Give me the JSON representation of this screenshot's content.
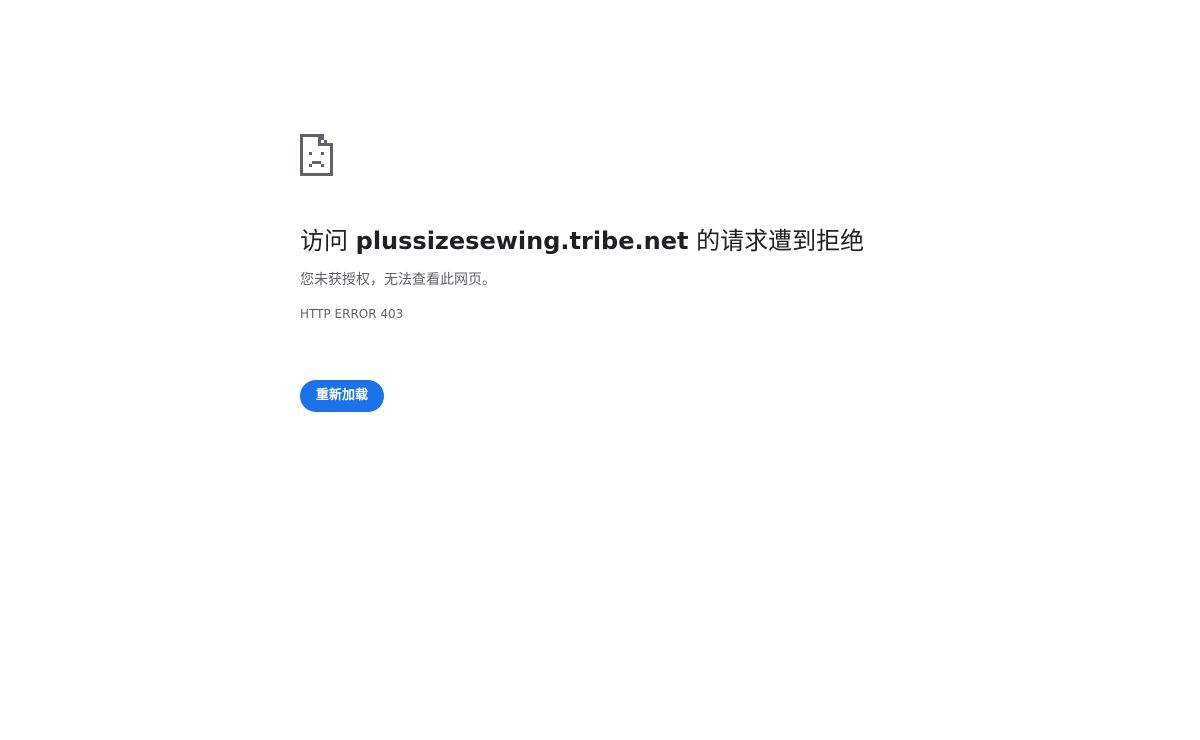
{
  "error_page": {
    "icon": "sad-document-icon",
    "title_prefix": "访问 ",
    "host": "plussizesewing.tribe.net",
    "title_suffix": " 的请求遭到拒绝",
    "description": "您未获授权，无法查看此网页。",
    "error_code": "HTTP ERROR 403",
    "reload_label": "重新加载"
  },
  "colors": {
    "accent": "#1a73e8",
    "text_primary": "#202124",
    "text_secondary": "#5f6368"
  }
}
